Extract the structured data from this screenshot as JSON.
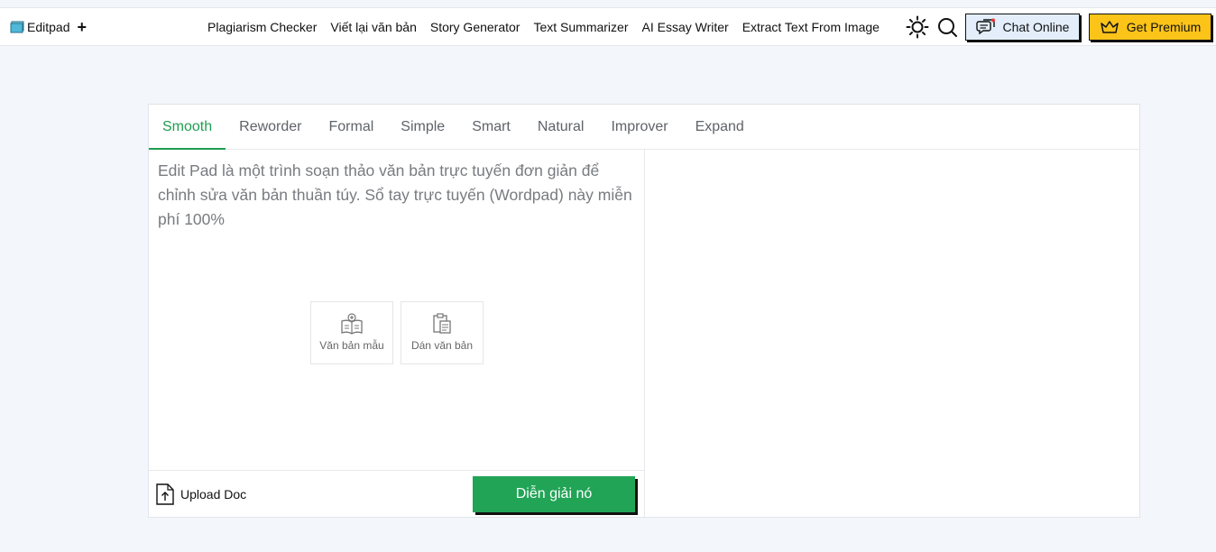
{
  "header": {
    "logo_text": "Editpad",
    "plus": "+",
    "nav": [
      "Plagiarism Checker",
      "Viết lại văn bản",
      "Story Generator",
      "Text Summarizer",
      "AI Essay Writer",
      "Extract Text From Image"
    ],
    "icons": [
      "sun-icon",
      "search-icon"
    ],
    "chat_label": "Chat Online",
    "premium_label": "Get Premium"
  },
  "tabs": [
    "Smooth",
    "Reworder",
    "Formal",
    "Simple",
    "Smart",
    "Natural",
    "Improver",
    "Expand"
  ],
  "active_tab": "Smooth",
  "editor": {
    "placeholder": "Edit Pad là một trình soạn thảo văn bản trực tuyến đơn giản để chỉnh sửa văn bản thuần túy. Sổ tay trực tuyến (Wordpad) này miễn phí 100%",
    "sample_label": "Văn bản mẫu",
    "paste_label": "Dán văn bản",
    "upload_label": "Upload Doc",
    "submit_label": "Diễn giải nó"
  },
  "colors": {
    "accent_green": "#21a456",
    "tab_active": "#1e9e50",
    "premium_yellow": "#fcc419",
    "chat_blue": "#e3eefa",
    "background": "#f3f6fa"
  }
}
